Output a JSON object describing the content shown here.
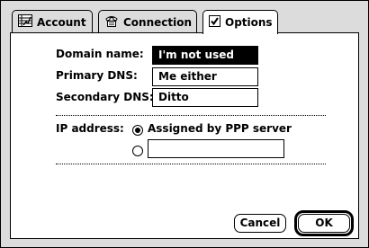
{
  "tabs": [
    {
      "label": "Account",
      "icon": "account-icon"
    },
    {
      "label": "Connection",
      "icon": "connection-icon"
    },
    {
      "label": "Options",
      "icon": "checkbox-icon"
    }
  ],
  "form": {
    "domain_label": "Domain name:",
    "domain_value": "I'm not used",
    "primary_dns_label": "Primary DNS:",
    "primary_dns_value": "Me either",
    "secondary_dns_label": "Secondary DNS:",
    "secondary_dns_value": "Ditto",
    "ip_label": "IP address:",
    "ip_option_assigned": "Assigned by PPP server",
    "ip_manual_value": ""
  },
  "buttons": {
    "cancel": "Cancel",
    "ok": "OK"
  }
}
